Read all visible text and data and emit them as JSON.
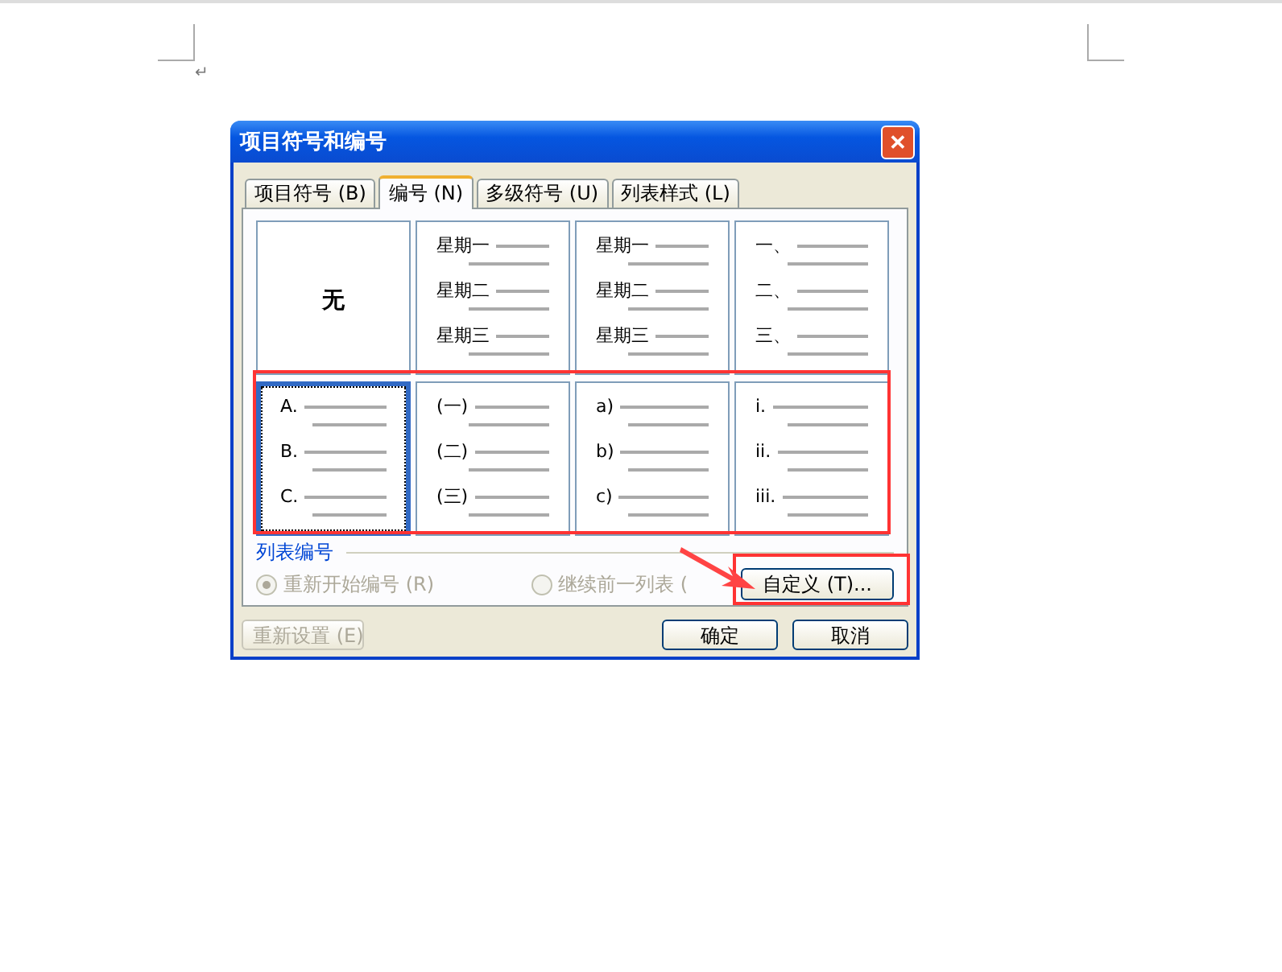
{
  "document": {
    "paragraph_mark": "↵"
  },
  "window": {
    "title": "项目符号和编号",
    "close": "✕"
  },
  "tabs": [
    {
      "label": "项目符号 (B)",
      "selected": false
    },
    {
      "label": "编号 (N)",
      "selected": true
    },
    {
      "label": "多级符号 (U)",
      "selected": false
    },
    {
      "label": "列表样式 (L)",
      "selected": false
    }
  ],
  "styles": [
    {
      "kind": "none",
      "label": "无",
      "selected": false
    },
    {
      "kind": "list",
      "markers": [
        "星期一",
        "星期二",
        "星期三"
      ],
      "selected": false
    },
    {
      "kind": "list",
      "markers": [
        "星期一",
        "星期二",
        "星期三"
      ],
      "selected": false
    },
    {
      "kind": "list",
      "markers": [
        "一、",
        "二、",
        "三、"
      ],
      "selected": false
    },
    {
      "kind": "list",
      "markers": [
        "A.",
        "B.",
        "C."
      ],
      "selected": true
    },
    {
      "kind": "list",
      "markers": [
        "(一)",
        "(二)",
        "(三)"
      ],
      "selected": false
    },
    {
      "kind": "list",
      "markers": [
        "a)",
        "b)",
        "c)"
      ],
      "selected": false
    },
    {
      "kind": "list",
      "markers": [
        "i.",
        "ii.",
        "iii."
      ],
      "selected": false
    }
  ],
  "section_label": "列表编号",
  "radios": [
    {
      "label": "重新开始编号 (R)",
      "selected": true,
      "disabled": true
    },
    {
      "label": "继续前一列表 (",
      "selected": false,
      "disabled": true
    }
  ],
  "customize_button": {
    "label": "自定义 (T)..."
  },
  "buttons": [
    {
      "label": "重新设置 (E)",
      "disabled": true
    },
    {
      "label": "确定",
      "disabled": false
    },
    {
      "label": "取消",
      "disabled": false
    }
  ]
}
